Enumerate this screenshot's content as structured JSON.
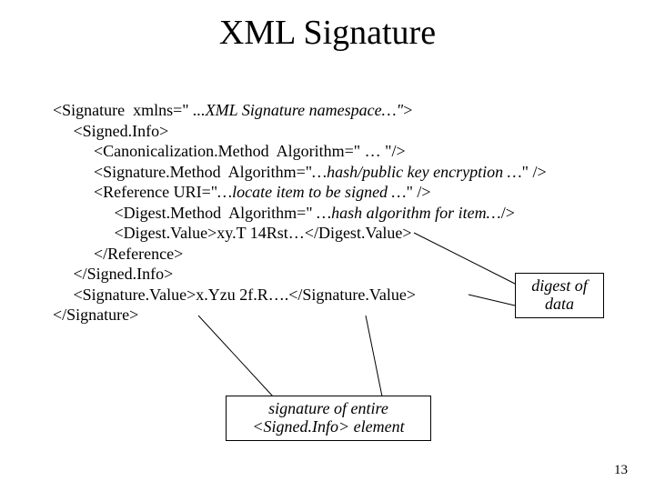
{
  "title": "XML Signature",
  "code": {
    "l1a": "<Signature  xmlns=\" ",
    "l1b": "...XML Signature namespace…\"",
    "l1c": ">",
    "l2": "     <Signed.Info>",
    "l3a": "          <Canonicalization.Method  Algorithm=\" … \"/>",
    "l4a": "          <Signature.Method  Algorithm=\"",
    "l4b": "…hash/public key encryption …",
    "l4c": "\" />",
    "l5a": "          <Reference URI=\"",
    "l5b": "…locate item to be signed …",
    "l5c": "\" />",
    "l6a": "               <Digest.Method  Algorithm=\" ",
    "l6b": "…hash algorithm for item…",
    "l6c": "/>",
    "l7a": "               <Digest.Value>xy.T 14Rst…</Digest.Value>",
    "l8": "          </Reference>",
    "l9": "     </Signed.Info>",
    "l10": "     <Signature.Value>x.Yzu 2f.R….</Signature.Value>",
    "l11": "</Signature>"
  },
  "callout1": "digest of\ndata",
  "callout2_line1": "signature of entire",
  "callout2_line2": "<Signed.Info> element",
  "pageNumber": "13"
}
